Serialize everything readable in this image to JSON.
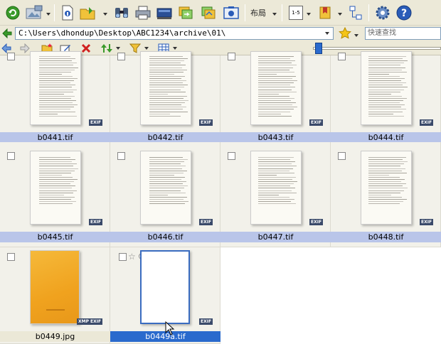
{
  "toolbar": {
    "layout_label": "布局",
    "page_label": "1-5",
    "colors": {
      "accent": "#2a6acd",
      "refresh": "#3a9a2a",
      "help": "#2a5cb8"
    }
  },
  "address": {
    "path": "C:\\Users\\dhondup\\Desktop\\ABC1234\\archive\\01\\",
    "search_placeholder": "快速查找"
  },
  "files": [
    {
      "name": "b0441.tif",
      "badge": "EXIF"
    },
    {
      "name": "b0442.tif",
      "badge": "EXIF"
    },
    {
      "name": "b0443.tif",
      "badge": "EXIF"
    },
    {
      "name": "b0444.tif",
      "badge": "EXIF"
    },
    {
      "name": "b0445.tif",
      "badge": "EXIF"
    },
    {
      "name": "b0446.tif",
      "badge": "EXIF"
    },
    {
      "name": "b0447.tif",
      "badge": "EXIF"
    },
    {
      "name": "b0448.tif",
      "badge": "EXIF"
    },
    {
      "name": "b0449.jpg",
      "badge": "EXIF",
      "badge2": "XMP"
    },
    {
      "name": "b0449a.tif",
      "badge": "EXIF"
    }
  ]
}
